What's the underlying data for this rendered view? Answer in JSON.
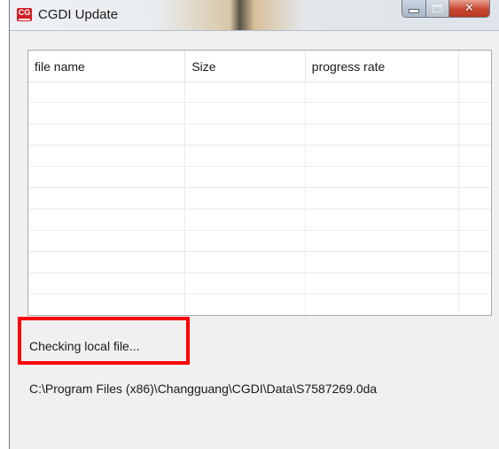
{
  "window": {
    "title": "CGDI Update",
    "logo_text": "CG",
    "caption_buttons": {
      "minimize_icon": "minimize-icon",
      "maximize_icon": "maximize-icon",
      "close_icon": "close-icon"
    }
  },
  "file_list": {
    "columns": [
      "file name",
      "Size",
      "progress rate"
    ],
    "rows": []
  },
  "status": {
    "message": "Checking local file...",
    "path": "C:\\Program Files (x86)\\Changguang\\CGDI\\Data\\S7587269.0da"
  },
  "colors": {
    "highlight": "#ff0000",
    "logo": "#d21f27",
    "close_button": "#c8472f"
  }
}
